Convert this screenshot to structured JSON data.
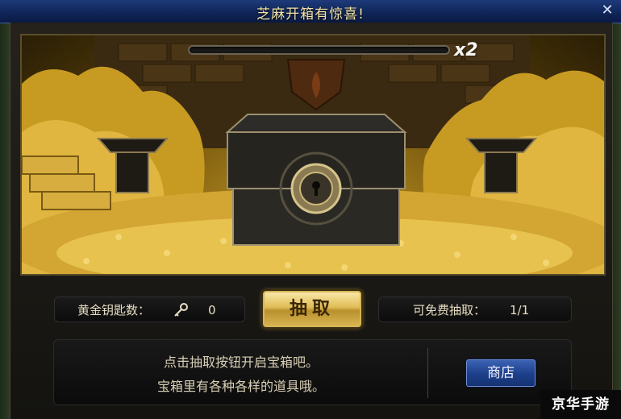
{
  "window": {
    "title": "芝麻开箱有惊喜!",
    "close_icon": "close-icon",
    "close_glyph": "✕"
  },
  "scene": {
    "progress": 0,
    "multiplier": "x2",
    "chest_icon": "treasure-chest-icon"
  },
  "stats": {
    "gold_keys_label": "黄金钥匙数：",
    "gold_keys_icon": "key-icon",
    "gold_keys_value": "0",
    "free_draws_label": "可免费抽取：",
    "free_draws_value": "1/1"
  },
  "draw_button_label": "抽取",
  "info": {
    "line1": "点击抽取按钮开启宝箱吧。",
    "line2": "宝箱里有各种各样的道具哦。",
    "shop_button_label": "商店"
  },
  "watermark": "京华手游",
  "colors": {
    "title_bar": "#0f2557",
    "gold_accent": "#e0bc56",
    "shop_button": "#1d3f8a"
  }
}
